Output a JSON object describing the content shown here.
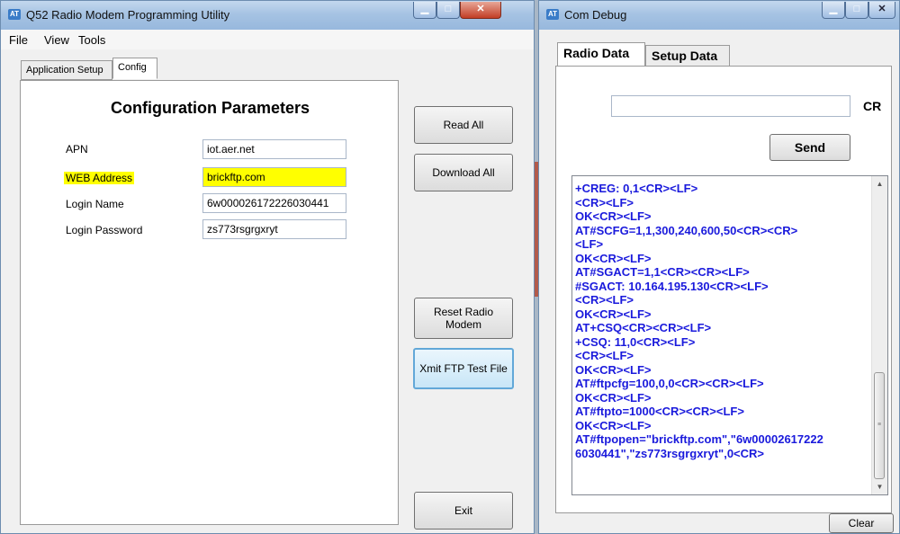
{
  "left_window": {
    "title": "Q52 Radio Modem Programming Utility",
    "menu": [
      "File",
      "View",
      "Tools"
    ],
    "tabs": [
      "Application Setup",
      "Config"
    ],
    "heading": "Configuration Parameters",
    "fields": [
      {
        "label": "APN",
        "value": "iot.aer.net"
      },
      {
        "label": "WEB Address",
        "value": "brickftp.com"
      },
      {
        "label": "Login Name",
        "value": "6w000026172226030441"
      },
      {
        "label": "Login Password",
        "value": "zs773rsgrgxryt"
      }
    ],
    "buttons": {
      "read_all": "Read All",
      "download_all": "Download All",
      "reset_line1": "Reset Radio",
      "reset_line2": "Modem",
      "xmit": "Xmit FTP Test File",
      "exit": "Exit"
    }
  },
  "right_window": {
    "title": "Com Debug",
    "tabs": [
      "Radio Data",
      "Setup Data"
    ],
    "command_input": "",
    "cr_label": "CR",
    "send_label": "Send",
    "clear_label": "Clear",
    "log_lines": [
      "+CREG: 0,1<CR><LF>",
      "<CR><LF>",
      "OK<CR><LF>",
      "AT#SCFG=1,1,300,240,600,50<CR><CR>",
      "<LF>",
      "OK<CR><LF>",
      "AT#SGACT=1,1<CR><CR><LF>",
      "#SGACT: 10.164.195.130<CR><LF>",
      "<CR><LF>",
      "OK<CR><LF>",
      "AT+CSQ<CR><CR><LF>",
      "+CSQ: 11,0<CR><LF>",
      "<CR><LF>",
      "OK<CR><LF>",
      "AT#ftpcfg=100,0,0<CR><CR><LF>",
      "OK<CR><LF>",
      "AT#ftpto=1000<CR><CR><LF>",
      "OK<CR><LF>",
      "AT#ftpopen=\"brickftp.com\",\"6w00002617222",
      "6030441\",\"zs773rsgrgxryt\",0<CR>"
    ]
  },
  "colors": {
    "highlight": "#ffff00",
    "log_text": "#1a1adc",
    "title_bar": "#a6c3e3",
    "close_button": "#c23d25"
  },
  "icons": {
    "app_icon": "app-icon",
    "minimize": "minimize-icon",
    "maximize": "maximize-icon",
    "close": "close-icon"
  }
}
